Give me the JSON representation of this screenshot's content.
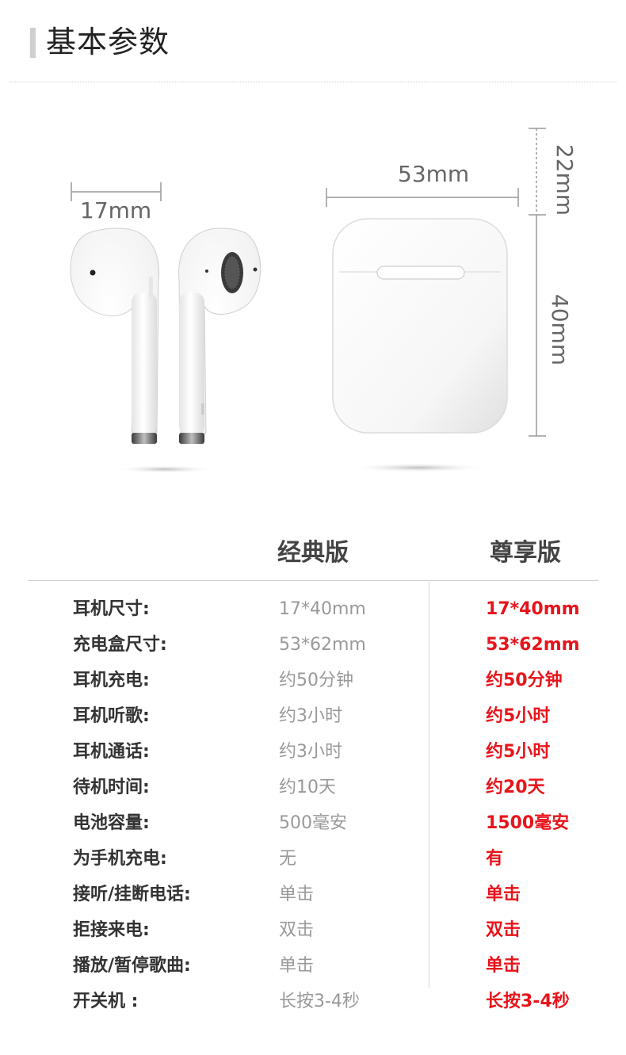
{
  "header": {
    "title": "基本参数"
  },
  "dimensions": {
    "earbud_width": "17mm",
    "case_width": "53mm",
    "case_lid": "22mm",
    "case_height": "40mm"
  },
  "table": {
    "columns": [
      "经典版",
      "尊享版"
    ],
    "rows": [
      {
        "label": "耳机尺寸:",
        "classic": "17*40mm",
        "premium": "17*40mm"
      },
      {
        "label": "充电盒尺寸:",
        "classic": "53*62mm",
        "premium": "53*62mm"
      },
      {
        "label": "耳机充电:",
        "classic": "约50分钟",
        "premium": "约50分钟"
      },
      {
        "label": "耳机听歌:",
        "classic": "约3小时",
        "premium": "约5小时"
      },
      {
        "label": "耳机通话:",
        "classic": "约3小时",
        "premium": "约5小时"
      },
      {
        "label": "待机时间:",
        "classic": "约10天",
        "premium": "约20天"
      },
      {
        "label": "电池容量:",
        "classic": "500毫安",
        "premium": "1500毫安"
      },
      {
        "label": "为手机充电:",
        "classic": "无",
        "premium": "有"
      },
      {
        "label": "接听/挂断电话:",
        "classic": "单击",
        "premium": "单击"
      },
      {
        "label": "拒接来电:",
        "classic": "双击",
        "premium": "双击"
      },
      {
        "label": "播放/暂停歌曲:",
        "classic": "单击",
        "premium": "单击"
      },
      {
        "label": "开关机 :",
        "classic": "长按3-4秒",
        "premium": "长按3-4秒"
      }
    ]
  },
  "colors": {
    "premium_text": "#e8141b",
    "classic_text": "#999999",
    "label_text": "#333333"
  }
}
